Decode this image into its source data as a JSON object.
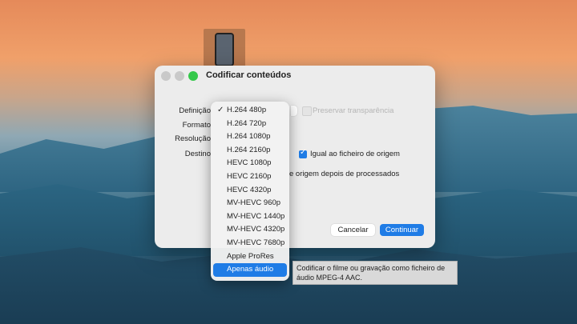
{
  "window": {
    "title": "Codificar conteúdos"
  },
  "labels": {
    "definicao": "Definição",
    "formato": "Formato",
    "resolucao": "Resolução",
    "destino": "Destino"
  },
  "options": {
    "preservar": {
      "label": "Preservar transparência",
      "checked": false,
      "enabled": false
    },
    "igual_origem": {
      "label": "Igual ao ficheiro de origem",
      "checked": true
    },
    "apagar_origem": {
      "label": "e origem depois de processados",
      "checked": false
    }
  },
  "buttons": {
    "cancel": "Cancelar",
    "continue": "Continuar"
  },
  "menu": {
    "items": [
      {
        "label": "H.264 480p",
        "checked": true
      },
      {
        "label": "H.264 720p"
      },
      {
        "label": "H.264 1080p"
      },
      {
        "label": "H.264 2160p"
      },
      {
        "label": "HEVC 1080p"
      },
      {
        "label": "HEVC 2160p"
      },
      {
        "label": "HEVC 4320p"
      },
      {
        "label": "MV-HEVC 960p"
      },
      {
        "label": "MV-HEVC 1440p"
      },
      {
        "label": "MV-HEVC 4320p"
      },
      {
        "label": "MV-HEVC 7680p"
      },
      {
        "label": "Apple ProRes"
      },
      {
        "label": "Apenas áudio",
        "highlighted": true
      }
    ]
  },
  "tooltip": "Codificar o filme ou gravação como ficheiro de áudio MPEG-4 AAC.",
  "colors": {
    "accent": "#1f7ce6",
    "green_button": "#34c84a"
  },
  "icons": {
    "file_thumbnail": "video-file-thumbnail-icon"
  }
}
